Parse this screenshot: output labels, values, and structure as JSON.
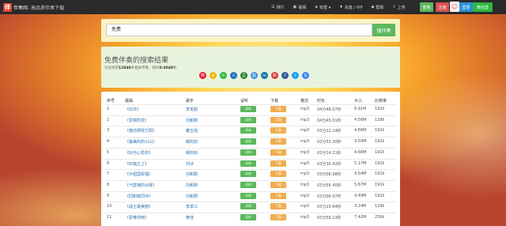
{
  "header": {
    "logo_char": "伴",
    "site_name": "伴奏网",
    "site_tag": "- 高品质伴奏下载",
    "nav": [
      {
        "icon": "ranking-icon",
        "glyph": "☰",
        "label": "排行"
      },
      {
        "icon": "video-icon",
        "glyph": "▣",
        "label": "视频"
      },
      {
        "icon": "category-icon",
        "glyph": "◈",
        "label": "标签 ▾"
      },
      {
        "icon": "recharge-icon",
        "glyph": "♦",
        "label": "充值 / VIP"
      },
      {
        "icon": "help-icon",
        "glyph": "◆",
        "label": "帮助"
      },
      {
        "icon": "upload-icon",
        "glyph": "⇧",
        "label": "上传"
      }
    ],
    "checkin_label": "签到",
    "register_label": "注册",
    "qq_label": "登录",
    "wechat_label": "微信登",
    "avatar_glyph": "☺"
  },
  "search": {
    "value": "免费",
    "button_label": "搜伴奏"
  },
  "results": {
    "title": "免费伴奏的搜索结果",
    "sub_prefix": "为您找到",
    "count": "12849",
    "sub_mid": "条相关伴奏，耗时",
    "time": "0.0048",
    "sub_suffix": "秒",
    "shares": [
      {
        "icon": "weibo-icon",
        "color": "#e6162d",
        "glyph": "微"
      },
      {
        "icon": "qzone-icon",
        "color": "#f5b400",
        "glyph": "★"
      },
      {
        "icon": "wechat-icon",
        "color": "#2bb840",
        "glyph": "✆"
      },
      {
        "icon": "renren-icon",
        "color": "#1f6fc2",
        "glyph": "人"
      },
      {
        "icon": "douban-icon",
        "color": "#2a7d2a",
        "glyph": "豆"
      },
      {
        "icon": "tieba-icon",
        "color": "#3b8fd9",
        "glyph": "贴"
      },
      {
        "icon": "linkedin-icon",
        "color": "#0e76a8",
        "glyph": "in"
      },
      {
        "icon": "sina-icon",
        "color": "#d63a3a",
        "glyph": "新"
      },
      {
        "icon": "facebook-icon",
        "color": "#3b5998",
        "glyph": "f"
      },
      {
        "icon": "twitter-icon",
        "color": "#1da1f2",
        "glyph": "t"
      },
      {
        "icon": "google-icon",
        "color": "#4285f4",
        "glyph": "G"
      }
    ]
  },
  "table": {
    "headers": [
      "序号",
      "歌曲",
      "歌手",
      "试听",
      "下载",
      "格式",
      "时长",
      "大小",
      "比特率"
    ],
    "listen_label": "试听",
    "download_label": "下载",
    "rows": [
      {
        "no": "1",
        "song": "《红日》",
        "singer": "李克勤",
        "format": "mp3",
        "duration": "04分48.07秒",
        "size": "6.91M",
        "bitrate": "192k"
      },
      {
        "no": "2",
        "song": "《爱我所爱》",
        "singer": "刘和刚",
        "format": "mp3",
        "duration": "04分45.01秒",
        "size": "4.56M",
        "bitrate": "128k"
      },
      {
        "no": "3",
        "song": "《像你那样丌阳》",
        "singer": "戴玉强",
        "format": "mp3",
        "duration": "03分22.14秒",
        "size": "4.66M",
        "bitrate": "192k"
      },
      {
        "no": "4",
        "song": "《最美的的小山》",
        "singer": "郁钧剑",
        "format": "mp3",
        "duration": "02分32.20秒",
        "size": "3.59M",
        "bitrate": "192k"
      },
      {
        "no": "5",
        "song": "《好与心爱的》",
        "singer": "郁钧剑",
        "format": "mp3",
        "duration": "03分14.21秒",
        "size": "4.66M",
        "bitrate": "192k"
      },
      {
        "no": "6",
        "song": "《红旗之上》",
        "singer": "刘冰",
        "format": "mp3",
        "duration": "03分36.42秒",
        "size": "5.17M",
        "bitrate": "192k"
      },
      {
        "no": "7",
        "song": "《为祖国祝福》",
        "singer": "刘和刚",
        "format": "mp3",
        "duration": "03分06.98秒",
        "size": "4.54M",
        "bitrate": "192k"
      },
      {
        "no": "8",
        "song": "《弋壁滩的对歌》",
        "singer": "刘和刚",
        "format": "mp3",
        "duration": "03分56.45秒",
        "size": "5.67M",
        "bitrate": "192k"
      },
      {
        "no": "9",
        "song": "《同和我同伴》",
        "singer": "刘和刚",
        "format": "mp3",
        "duration": "03分06.97秒",
        "size": "4.49M",
        "bitrate": "192k"
      },
      {
        "no": "10",
        "song": "《战士最美丽》",
        "singer": "李翠江",
        "format": "mp3",
        "duration": "03分29.64秒",
        "size": "3.24M",
        "bitrate": "128k"
      },
      {
        "no": "11",
        "song": "《爱唯你吧》",
        "singer": "黄佳",
        "format": "mp3",
        "duration": "03分59.13秒",
        "size": "7.42M",
        "bitrate": "256k"
      }
    ]
  }
}
